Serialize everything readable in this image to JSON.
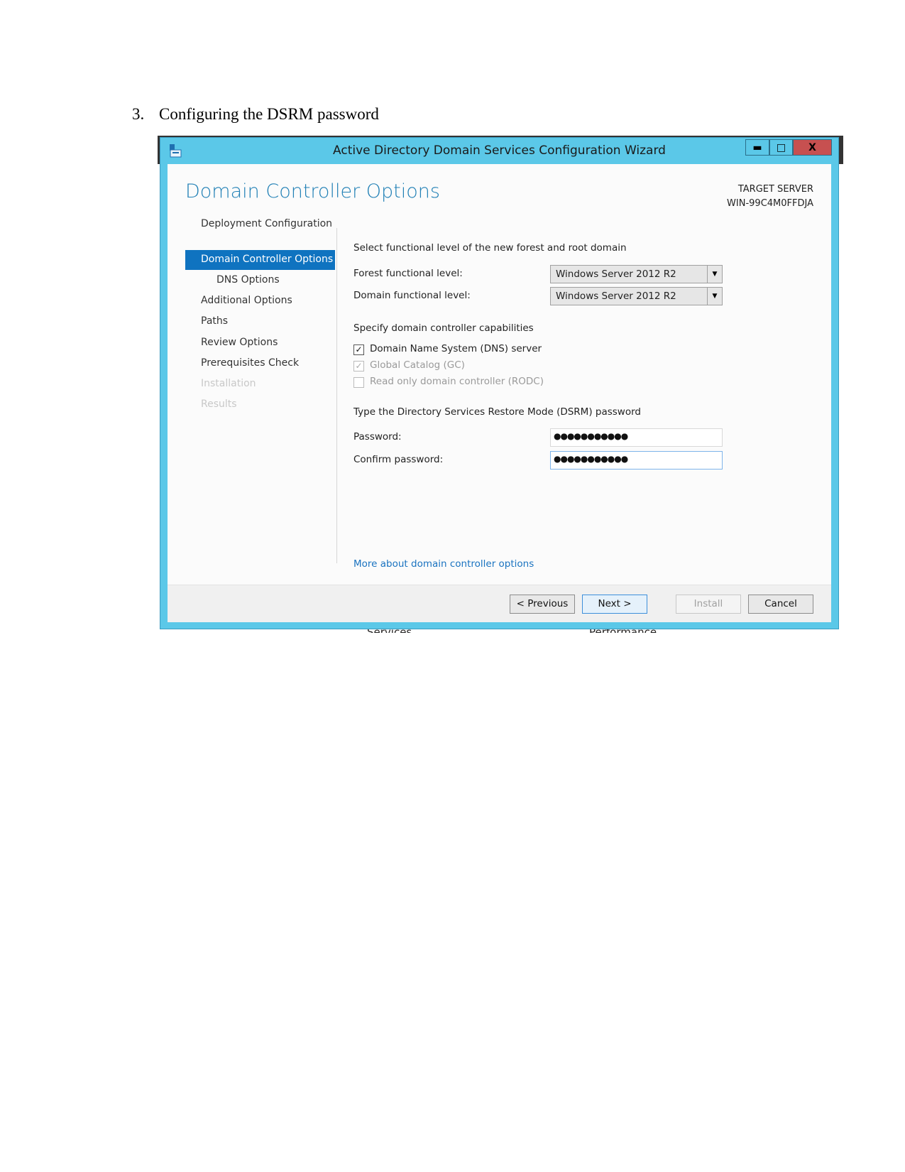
{
  "document": {
    "step_number": "3.",
    "step_title": "Configuring the DSRM password"
  },
  "background_window": {
    "labels": [
      "Services",
      "Performance"
    ]
  },
  "window": {
    "title": "Active Directory Domain Services Configuration Wizard",
    "controls": {
      "minimize": "▬",
      "maximize": "□",
      "close": "X"
    },
    "accent_color": "#5bc8e8",
    "page_heading": "Domain Controller Options",
    "target_server_label": "TARGET SERVER",
    "target_server_name": "WIN-99C4M0FFDJA"
  },
  "nav": {
    "items": [
      {
        "label": "Deployment Configuration",
        "state": "done"
      },
      {
        "label": "Domain Controller Options",
        "state": "selected"
      },
      {
        "label": "DNS Options",
        "state": "sub"
      },
      {
        "label": "Additional Options",
        "state": "normal"
      },
      {
        "label": "Paths",
        "state": "normal"
      },
      {
        "label": "Review Options",
        "state": "normal"
      },
      {
        "label": "Prerequisites Check",
        "state": "normal"
      },
      {
        "label": "Installation",
        "state": "disabled"
      },
      {
        "label": "Results",
        "state": "disabled"
      }
    ]
  },
  "form": {
    "functional_heading": "Select functional level of the new forest and root domain",
    "forest_label": "Forest functional level:",
    "forest_value": "Windows Server 2012 R2",
    "domain_label": "Domain functional level:",
    "domain_value": "Windows Server 2012 R2",
    "capabilities_heading": "Specify domain controller capabilities",
    "dns_label": "Domain Name System (DNS) server",
    "dns_checked": true,
    "gc_label": "Global Catalog (GC)",
    "gc_checked": true,
    "rodc_label": "Read only domain controller (RODC)",
    "rodc_checked": false,
    "dsrm_heading": "Type the Directory Services Restore Mode (DSRM) password",
    "password_label": "Password:",
    "password_value": "●●●●●●●●●●●",
    "confirm_label": "Confirm password:",
    "confirm_value": "●●●●●●●●●●●",
    "more_link": "More about domain controller options"
  },
  "footer": {
    "previous": "< Previous",
    "next": "Next >",
    "install": "Install",
    "cancel": "Cancel"
  }
}
